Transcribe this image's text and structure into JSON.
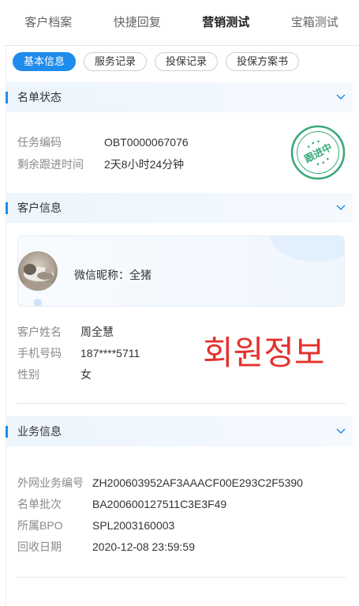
{
  "colors": {
    "accent": "#1f8ceb",
    "stamp": "#3aa978",
    "overlay_text": "#e4322c"
  },
  "tabs": [
    {
      "label": "客户档案",
      "active": false
    },
    {
      "label": "快捷回复",
      "active": false
    },
    {
      "label": "营销测试",
      "active": true
    },
    {
      "label": "宝箱测试",
      "active": false
    }
  ],
  "subtabs": [
    {
      "label": "基本信息",
      "active": true
    },
    {
      "label": "服务记录",
      "active": false
    },
    {
      "label": "投保记录",
      "active": false
    },
    {
      "label": "投保方案书",
      "active": false
    }
  ],
  "sections": {
    "list_status": {
      "title": "名单状态",
      "icon": "chevron-down-icon",
      "fields": [
        {
          "label": "任务编码",
          "value": "OBT0000067076"
        },
        {
          "label": "剩余跟进时间",
          "value": "2天8小时24分钟"
        }
      ],
      "stamp": {
        "text": "跟进中"
      }
    },
    "customer_info": {
      "title": "客户信息",
      "icon": "chevron-down-icon",
      "wechat": {
        "label": "微信昵称：",
        "nickname": "全猪",
        "avatar_icon": "cat-photo-avatar"
      },
      "fields": [
        {
          "label": "客户姓名",
          "value": "周全慧"
        },
        {
          "label": "手机号码",
          "value": "187****5711"
        },
        {
          "label": "性别",
          "value": "女"
        }
      ],
      "overlay_text": "회원정보"
    },
    "business_info": {
      "title": "业务信息",
      "icon": "chevron-down-icon",
      "fields": [
        {
          "label": "外网业务编号",
          "value": "ZH200603952AF3AAACF00E293C2F5390"
        },
        {
          "label": "名单批次",
          "value": "BA200600127511C3E3F49"
        },
        {
          "label": "所属BPO",
          "value": "SPL2003160003"
        },
        {
          "label": "回收日期",
          "value": "2020-12-08 23:59:59"
        }
      ]
    }
  }
}
